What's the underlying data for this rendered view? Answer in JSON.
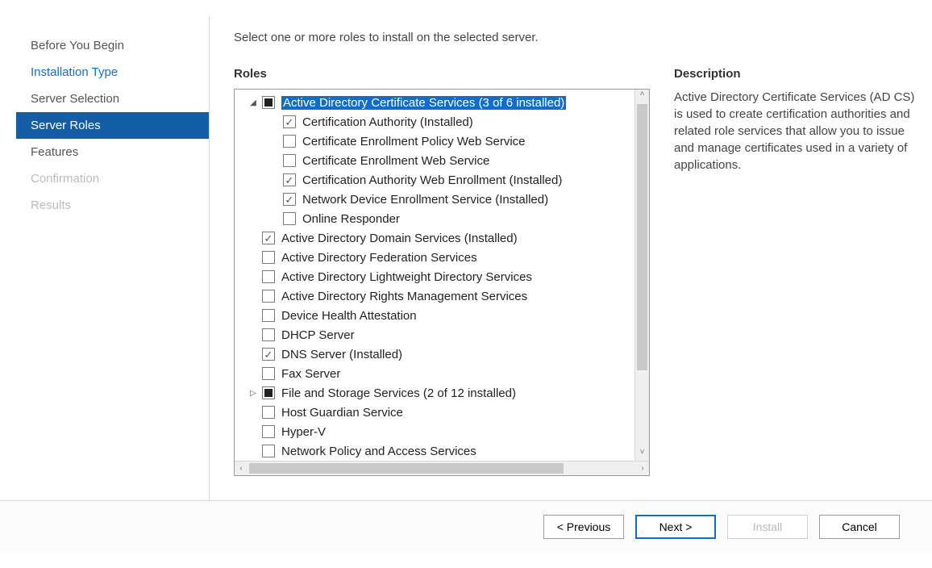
{
  "colors": {
    "accent": "#145ea8",
    "link": "#0f6ecd"
  },
  "steps": [
    {
      "label": "Before You Begin",
      "state": "normal"
    },
    {
      "label": "Installation Type",
      "state": "link"
    },
    {
      "label": "Server Selection",
      "state": "normal"
    },
    {
      "label": "Server Roles",
      "state": "active"
    },
    {
      "label": "Features",
      "state": "normal"
    },
    {
      "label": "Confirmation",
      "state": "disabled"
    },
    {
      "label": "Results",
      "state": "disabled"
    }
  ],
  "intro": "Select one or more roles to install on the selected server.",
  "roles_title": "Roles",
  "description_title": "Description",
  "description_text": "Active Directory Certificate Services (AD CS) is used to create certification authorities and related role services that allow you to issue and manage certificates used in a variety of applications.",
  "roles": [
    {
      "label": "Active Directory Certificate Services (3 of 6 installed)",
      "state": "partial",
      "expander": "expanded",
      "selected": true,
      "children": [
        {
          "label": "Certification Authority (Installed)",
          "state": "checked"
        },
        {
          "label": "Certificate Enrollment Policy Web Service",
          "state": "unchecked"
        },
        {
          "label": "Certificate Enrollment Web Service",
          "state": "unchecked"
        },
        {
          "label": "Certification Authority Web Enrollment (Installed)",
          "state": "checked"
        },
        {
          "label": "Network Device Enrollment Service (Installed)",
          "state": "checked"
        },
        {
          "label": "Online Responder",
          "state": "unchecked"
        }
      ]
    },
    {
      "label": "Active Directory Domain Services (Installed)",
      "state": "checked"
    },
    {
      "label": "Active Directory Federation Services",
      "state": "unchecked"
    },
    {
      "label": "Active Directory Lightweight Directory Services",
      "state": "unchecked"
    },
    {
      "label": "Active Directory Rights Management Services",
      "state": "unchecked"
    },
    {
      "label": "Device Health Attestation",
      "state": "unchecked"
    },
    {
      "label": "DHCP Server",
      "state": "unchecked"
    },
    {
      "label": "DNS Server (Installed)",
      "state": "checked"
    },
    {
      "label": "Fax Server",
      "state": "unchecked"
    },
    {
      "label": "File and Storage Services (2 of 12 installed)",
      "state": "partial",
      "expander": "collapsed"
    },
    {
      "label": "Host Guardian Service",
      "state": "unchecked"
    },
    {
      "label": "Hyper-V",
      "state": "unchecked"
    },
    {
      "label": "Network Policy and Access Services",
      "state": "unchecked"
    }
  ],
  "buttons": {
    "previous": "< Previous",
    "next": "Next >",
    "install": "Install",
    "cancel": "Cancel"
  }
}
